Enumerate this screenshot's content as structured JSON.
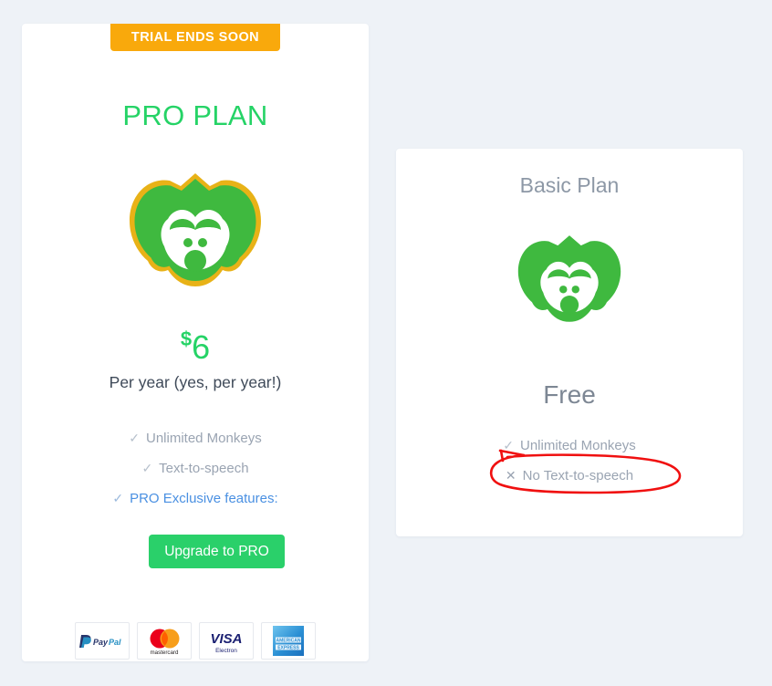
{
  "page": {
    "background_color": "#eef2f7"
  },
  "pro_plan": {
    "badge": "TRIAL ENDS SOON",
    "badge_color": "#f9a90c",
    "title": "PRO PLAN",
    "title_color": "#25d366",
    "logo_name": "monkey-logo-gold-outline",
    "price_currency": "$",
    "price_amount": "6",
    "price_color": "#25d366",
    "price_period": "Per year (yes, per year!)",
    "features": [
      {
        "icon": "check",
        "label": "Unlimited Monkeys",
        "is_link": false
      },
      {
        "icon": "check",
        "label": "Text-to-speech",
        "is_link": false
      },
      {
        "icon": "check",
        "label": "PRO Exclusive features:",
        "is_link": true
      }
    ],
    "cta_label": "Upgrade to PRO",
    "cta_color": "#2ad06a",
    "payment_methods": [
      {
        "name": "paypal",
        "label": "PayPal"
      },
      {
        "name": "mastercard",
        "label": "mastercard"
      },
      {
        "name": "visa-electron",
        "label": "VISA",
        "sublabel": "Electron"
      },
      {
        "name": "american-express",
        "label": "AMERICAN EXPRESS"
      }
    ]
  },
  "basic_plan": {
    "title": "Basic Plan",
    "title_color": "#8d98a6",
    "logo_name": "monkey-logo-plain",
    "price": "Free",
    "price_color": "#7d8794",
    "features": [
      {
        "icon": "check",
        "label": "Unlimited Monkeys"
      },
      {
        "icon": "cross",
        "label": "No Text-to-speech"
      }
    ]
  },
  "annotation": {
    "shape": "hand-drawn-ellipse",
    "color": "#f01010",
    "targets": "No Text-to-speech"
  }
}
